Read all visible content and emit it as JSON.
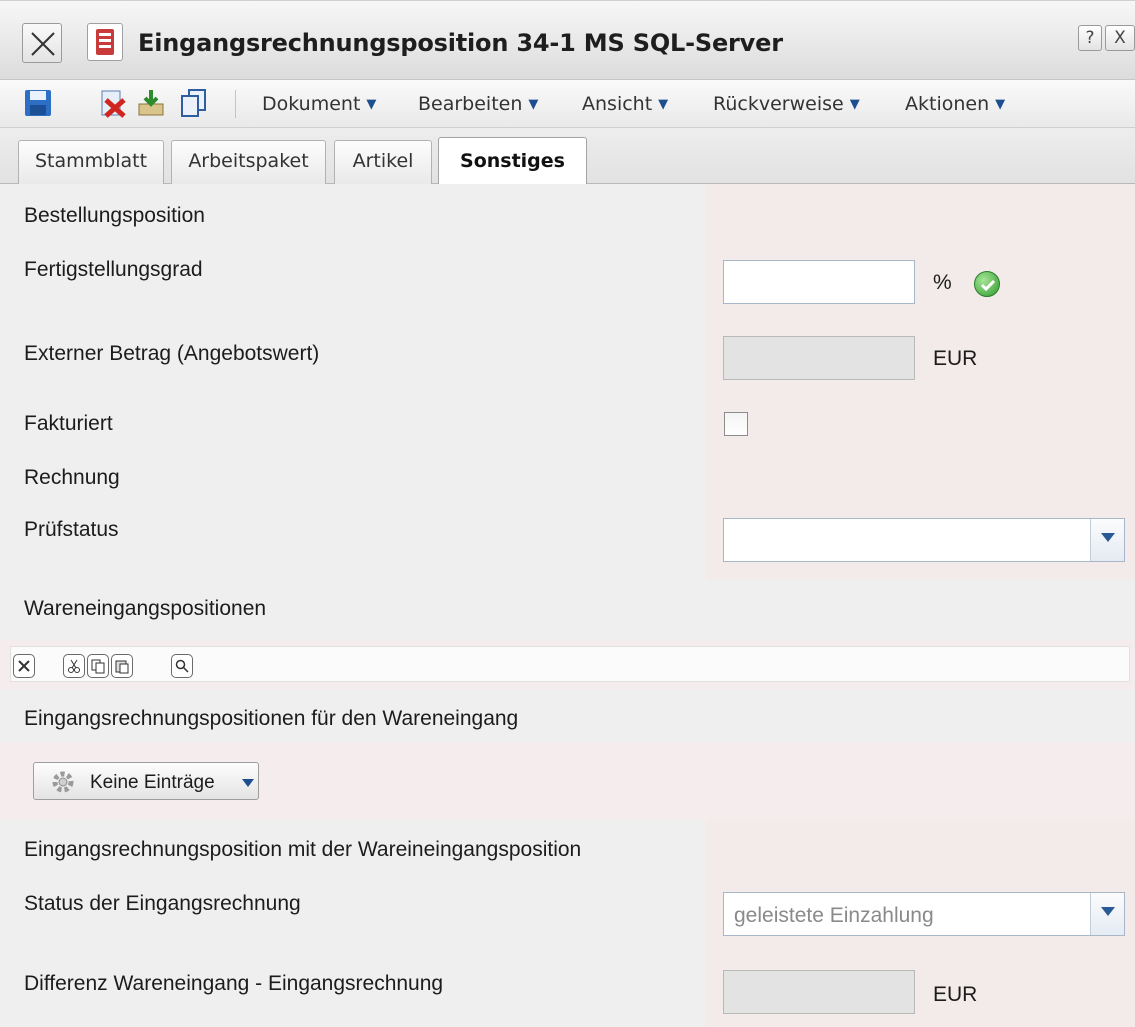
{
  "window": {
    "title": "Eingangsrechnungsposition 34-1 MS SQL-Server",
    "help_label": "?",
    "close_label": "X"
  },
  "toolbar": {
    "menus": [
      {
        "label": "Dokument"
      },
      {
        "label": "Bearbeiten"
      },
      {
        "label": "Ansicht"
      },
      {
        "label": "Rückverweise"
      },
      {
        "label": "Aktionen"
      }
    ],
    "icons": [
      "save-icon",
      "delete-icon",
      "export-icon",
      "copy-icon"
    ]
  },
  "tabs": [
    {
      "label": "Stammblatt",
      "active": false
    },
    {
      "label": "Arbeitspaket",
      "active": false
    },
    {
      "label": "Artikel",
      "active": false
    },
    {
      "label": "Sonstiges",
      "active": true
    }
  ],
  "form": {
    "bestellungsposition": {
      "label": "Bestellungsposition"
    },
    "fertigstellungsgrad": {
      "label": "Fertigstellungsgrad",
      "value": "",
      "unit": "%"
    },
    "externer_betrag": {
      "label": "Externer Betrag (Angebotswert)",
      "value": "",
      "unit": "EUR"
    },
    "fakturiert": {
      "label": "Fakturiert",
      "checked": false
    },
    "rechnung": {
      "label": "Rechnung"
    },
    "pruefstatus": {
      "label": "Prüfstatus",
      "value": ""
    },
    "wareneingangspositionen": {
      "label": "Wareneingangspositionen"
    },
    "eingangsrechnungspositionen_we": {
      "label": "Eingangsrechnungspositionen für den Wareneingang",
      "button_label": "Keine Einträge"
    },
    "erp_mit_wep": {
      "label": "Eingangsrechnungsposition mit der Wareineingangsposition"
    },
    "status_eingangsrechnung": {
      "label": "Status der Eingangsrechnung",
      "value": "geleistete Einzahlung"
    },
    "differenz": {
      "label": "Differenz Wareneingang - Eingangsrechnung",
      "value": "",
      "unit": "EUR"
    }
  },
  "colors": {
    "accent": "#1d4f8f",
    "label_bg": "#efefef",
    "value_bg": "#f3eaea",
    "ok_green": "#2e9a2e"
  }
}
